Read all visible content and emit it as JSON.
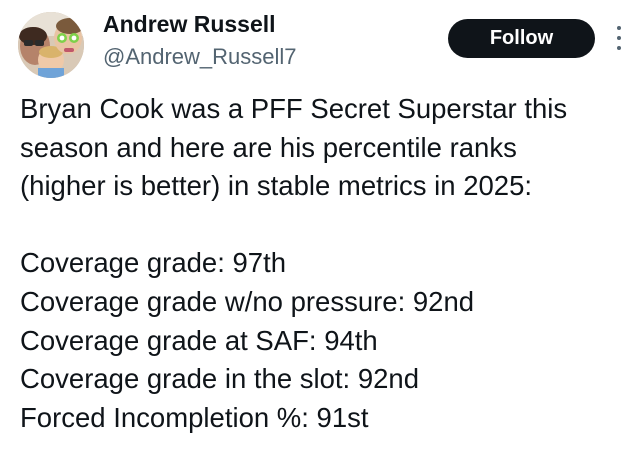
{
  "author": {
    "name": "Andrew Russell",
    "handle": "@Andrew_Russell7"
  },
  "follow_button": {
    "label": "Follow"
  },
  "tweet": {
    "lines": [
      "Bryan Cook was a PFF Secret Superstar this",
      "season and here are his percentile ranks",
      "(higher is better) in stable metrics in 2025:",
      "",
      "Coverage grade: 97th",
      "Coverage grade w/no pressure: 92nd",
      "Coverage grade at SAF: 94th",
      "Coverage grade in the slot: 92nd",
      "Forced Incompletion %: 91st"
    ]
  },
  "colors": {
    "text": "#0f1419",
    "secondary": "#536471",
    "follow_bg": "#0f1419",
    "follow_text": "#ffffff"
  },
  "icons": {
    "more": "more-vertical-icon"
  }
}
